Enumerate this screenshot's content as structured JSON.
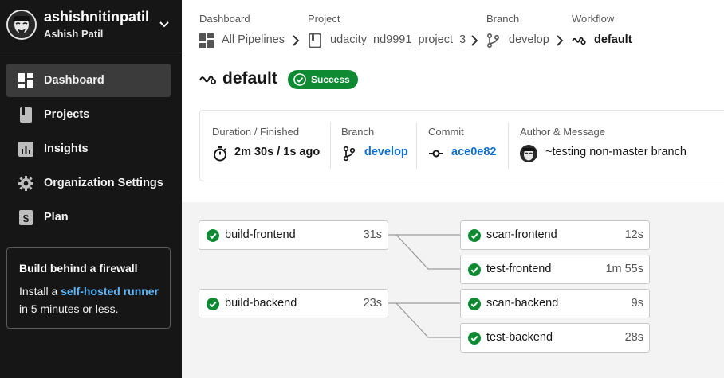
{
  "org": {
    "name": "ashishnitinpatil",
    "user": "Ashish Patil"
  },
  "nav": [
    {
      "label": "Dashboard",
      "icon": "dashboard-icon",
      "active": true
    },
    {
      "label": "Projects",
      "icon": "projects-icon",
      "active": false
    },
    {
      "label": "Insights",
      "icon": "insights-icon",
      "active": false
    },
    {
      "label": "Organization Settings",
      "icon": "gear-icon",
      "active": false
    },
    {
      "label": "Plan",
      "icon": "dollar-icon",
      "active": false
    }
  ],
  "promo": {
    "title": "Build behind a firewall",
    "pre": "Install a ",
    "link": "self-hosted runner",
    "post": " in 5 minutes or less."
  },
  "breadcrumb": {
    "dashboard": {
      "header": "Dashboard",
      "value": "All Pipelines"
    },
    "project": {
      "header": "Project",
      "value": "udacity_nd9991_project_3"
    },
    "branch": {
      "header": "Branch",
      "value": "develop"
    },
    "workflow": {
      "header": "Workflow",
      "value": "default"
    }
  },
  "page": {
    "title": "default",
    "status": "Success"
  },
  "info": {
    "duration": {
      "header": "Duration / Finished",
      "value": "2m 30s / 1s ago"
    },
    "branch": {
      "header": "Branch",
      "value": "develop"
    },
    "commit": {
      "header": "Commit",
      "value": "ace0e82"
    },
    "author": {
      "header": "Author & Message",
      "value": "~testing non-master branch"
    }
  },
  "jobs": [
    {
      "name": "build-frontend",
      "time": "31s",
      "status": "success"
    },
    {
      "name": "scan-frontend",
      "time": "12s",
      "status": "success"
    },
    {
      "name": "test-frontend",
      "time": "1m 55s",
      "status": "success"
    },
    {
      "name": "build-backend",
      "time": "23s",
      "status": "success"
    },
    {
      "name": "scan-backend",
      "time": "9s",
      "status": "success"
    },
    {
      "name": "test-backend",
      "time": "28s",
      "status": "success"
    }
  ],
  "colors": {
    "success": "#0e8a33",
    "link": "#0e6ed6",
    "sidebar": "#161616",
    "promo_link": "#5cb8ff"
  }
}
